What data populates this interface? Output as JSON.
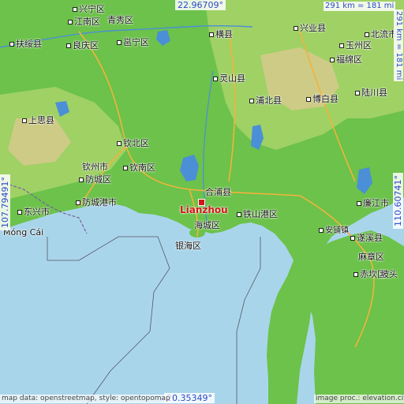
{
  "map": {
    "title": "Lianzhou",
    "highlight_label": "Lianzhou",
    "coords": {
      "top": "22.96709°",
      "bottom": "20.35349°",
      "left": "107.79491°",
      "right": "110.60741°"
    },
    "scale": {
      "top": "291 km = 181 mi",
      "right": "291 km = 181 mi"
    },
    "attribution_left": "map data: openstreetmap, style: opentopomap",
    "attribution_right": "image proc.: elevation.city",
    "places": [
      {
        "label": "兴宁区"
      },
      {
        "label": "江南区"
      },
      {
        "label": "青秀区"
      },
      {
        "label": "扶绥县"
      },
      {
        "label": "良庆区"
      },
      {
        "label": "邕宁区"
      },
      {
        "label": "横县"
      },
      {
        "label": "兴业县"
      },
      {
        "label": "北流市"
      },
      {
        "label": "玉州区"
      },
      {
        "label": "福绵区"
      },
      {
        "label": "灵山县"
      },
      {
        "label": "陆川县"
      },
      {
        "label": "浦北县"
      },
      {
        "label": "博白县"
      },
      {
        "label": "上思县"
      },
      {
        "label": "钦北区"
      },
      {
        "label": "钦州市"
      },
      {
        "label": "钦南区"
      },
      {
        "label": "防城区"
      },
      {
        "label": "合浦县"
      },
      {
        "label": "廉江市"
      },
      {
        "label": "东兴市"
      },
      {
        "label": "防城港市"
      },
      {
        "label": "铁山港区"
      },
      {
        "label": "海城区"
      },
      {
        "label": "安铺镇"
      },
      {
        "label": "遂溪县"
      },
      {
        "label": "银海区"
      },
      {
        "label": "麻章区"
      },
      {
        "label": "赤坎区"
      },
      {
        "label": "坡头"
      },
      {
        "label": "Móng Cái"
      }
    ],
    "colors": {
      "sea": "#a9d5ea",
      "lowland": "#6cc24a",
      "upland": "#a8d36a",
      "highland": "#d9c98f",
      "lake": "#4b8fd6",
      "road": "#f2b33d",
      "border": "#7a5fa0",
      "highlight": "#d01818",
      "coords": "#2a49c8"
    }
  }
}
